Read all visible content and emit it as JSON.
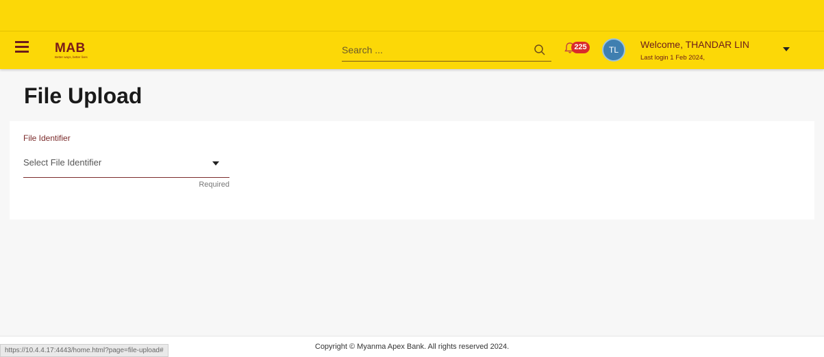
{
  "header": {
    "logo": "MAB",
    "tagline": "Better ways, better lives",
    "search_placeholder": "Search ...",
    "notification_count": "225",
    "avatar_initials": "TL",
    "welcome": "Welcome, THANDAR LIN",
    "last_login": "Last login 1 Feb 2024,"
  },
  "page": {
    "title": "File Upload"
  },
  "form": {
    "file_identifier": {
      "label": "File Identifier",
      "placeholder": "Select File Identifier",
      "hint": "Required"
    }
  },
  "footer": {
    "copyright": "Copyright © Myanma Apex Bank. All rights reserved 2024."
  },
  "statusbar": {
    "url": "https://10.4.4.17:4443/home.html?page=file-upload#"
  },
  "colors": {
    "brand_yellow": "#fcd807",
    "brand_maroon": "#7a1a1a",
    "badge_red": "#d92b2b"
  },
  "icons": [
    "menu-icon",
    "search-icon",
    "bell-icon",
    "chevron-down-icon"
  ]
}
